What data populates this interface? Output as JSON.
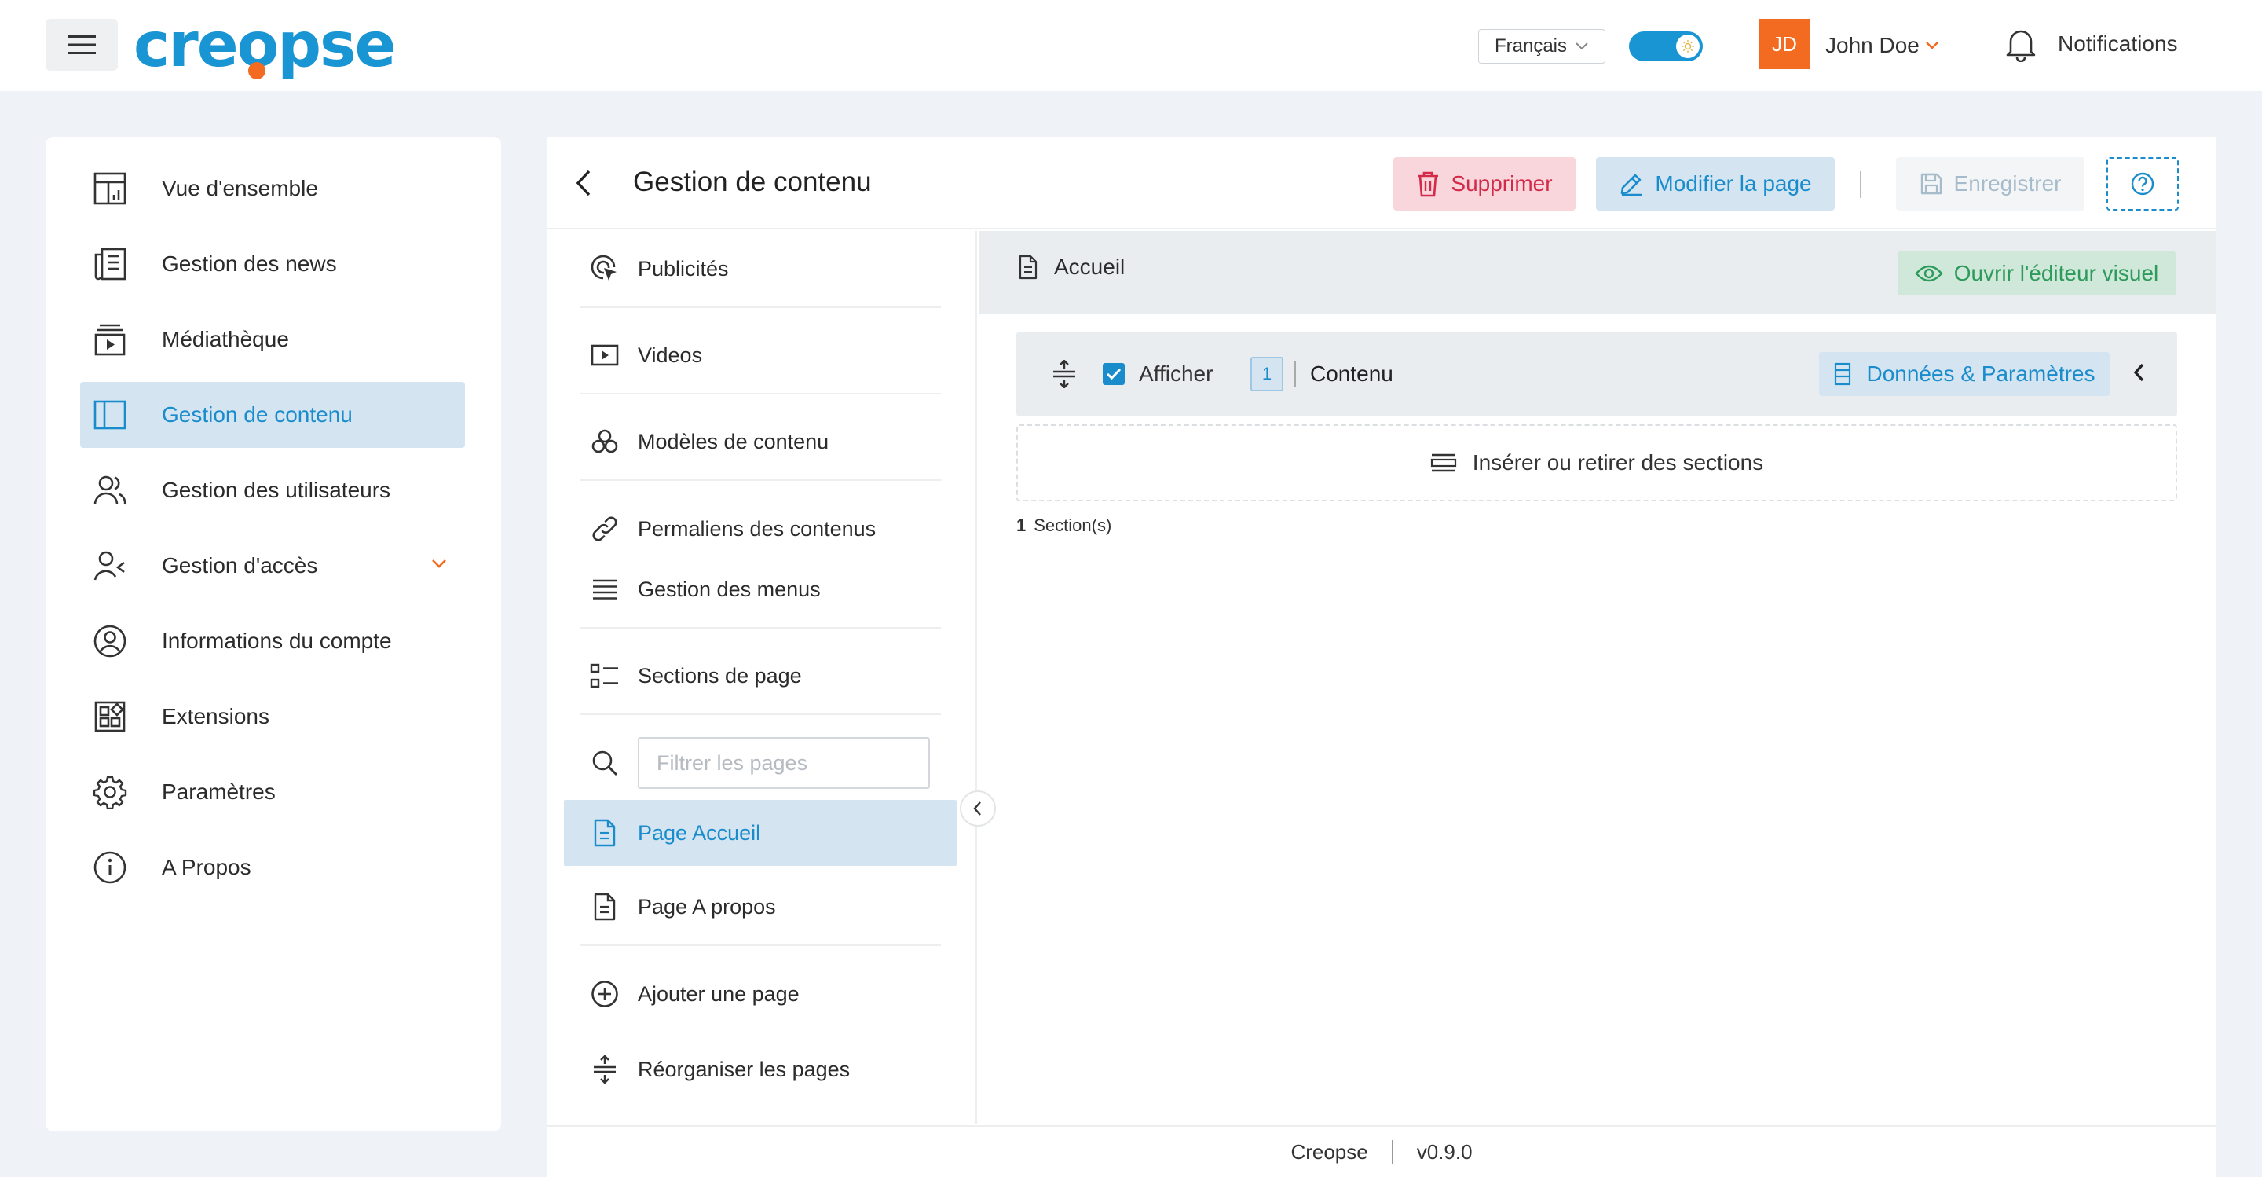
{
  "brand": {
    "logo_text_pre": "cre",
    "logo_text_o": "o",
    "logo_text_post": "pse"
  },
  "header": {
    "language": "Français",
    "user_initials": "JD",
    "user_name": "John Doe",
    "notifications_label": "Notifications"
  },
  "sidebar": {
    "items": [
      {
        "label": "Vue d'ensemble",
        "icon": "dashboard-icon"
      },
      {
        "label": "Gestion des news",
        "icon": "newspaper-icon"
      },
      {
        "label": "Médiathèque",
        "icon": "media-icon"
      },
      {
        "label": "Gestion de contenu",
        "icon": "layout-icon",
        "active": true
      },
      {
        "label": "Gestion des utilisateurs",
        "icon": "users-icon"
      },
      {
        "label": "Gestion d'accès",
        "icon": "user-access-icon",
        "expandable": true
      },
      {
        "label": "Informations du compte",
        "icon": "account-icon"
      },
      {
        "label": "Extensions",
        "icon": "extensions-icon"
      },
      {
        "label": "Paramètres",
        "icon": "gear-icon"
      },
      {
        "label": "A Propos",
        "icon": "info-icon"
      }
    ]
  },
  "main": {
    "title": "Gestion de contenu",
    "actions": {
      "delete": "Supprimer",
      "edit_page": "Modifier la page",
      "save": "Enregistrer"
    }
  },
  "midnav": {
    "items": [
      {
        "label": "Publicités",
        "icon": "cursor-click-icon"
      },
      {
        "label": "Videos",
        "icon": "video-icon"
      },
      {
        "label": "Modèles de contenu",
        "icon": "templates-icon"
      },
      {
        "label": "Permaliens des contenus",
        "icon": "link-icon"
      },
      {
        "label": "Gestion des menus",
        "icon": "menu-lines-icon"
      },
      {
        "label": "Sections de page",
        "icon": "sections-icon"
      }
    ],
    "filter_placeholder": "Filtrer les pages",
    "pages": [
      {
        "label": "Page Accueil",
        "active": true
      },
      {
        "label": "Page A propos"
      }
    ],
    "add_page": "Ajouter une page",
    "reorder_pages": "Réorganiser les pages"
  },
  "content": {
    "page_name": "Accueil",
    "visual_editor": "Ouvrir l'éditeur visuel",
    "section": {
      "show_label": "Afficher",
      "show_checked": true,
      "index": "1",
      "name": "Contenu",
      "data_button": "Données & Paramètres"
    },
    "insert_label": "Insérer ou retirer des sections",
    "section_count": "1",
    "section_count_label": "Section(s)"
  },
  "footer": {
    "app_name": "Creopse",
    "version": "v0.9.0"
  },
  "colors": {
    "accent": "#1a95d3",
    "brand_orange": "#f36b21",
    "danger": "#d22a48",
    "success": "#2e9b5c"
  }
}
